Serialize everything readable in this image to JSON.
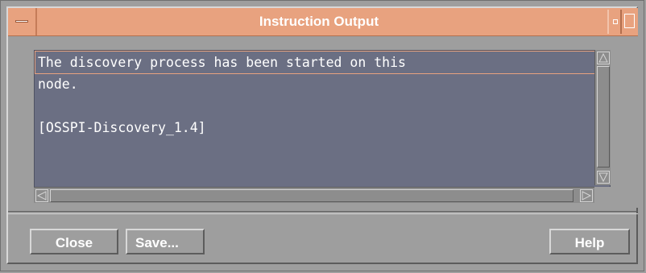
{
  "window": {
    "title": "Instruction Output"
  },
  "output": {
    "lines": [
      "The discovery process has been started on this",
      "node.",
      "",
      "[OSSPI-Discovery_1.4]"
    ]
  },
  "buttons": {
    "close_label": "Close",
    "save_label": "Save...",
    "help_label": "Help"
  },
  "colors": {
    "titlebar": "#e8a27f",
    "text_panel": "#6b6f83",
    "window_bg": "#9e9e9e"
  },
  "icons": {
    "window_menu": "window-menu-icon",
    "minimize": "minimize-icon",
    "maximize": "maximize-icon",
    "scroll_up": "scroll-up-arrow-icon",
    "scroll_down": "scroll-down-arrow-icon",
    "scroll_left": "scroll-left-arrow-icon",
    "scroll_right": "scroll-right-arrow-icon"
  }
}
